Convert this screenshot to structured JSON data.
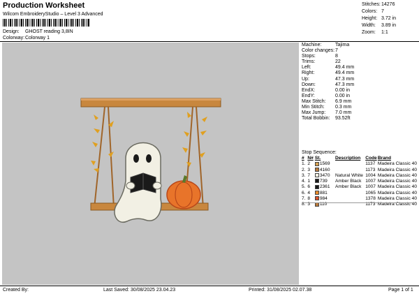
{
  "header": {
    "title": "Production Worksheet",
    "subtitle": "Wilcom EmbroideryStudio – Level 3 Advanced",
    "design_label": "Design:",
    "design_value": "GHOST reading 3,8IN",
    "colorway_label": "Colorway:",
    "colorway_value": "Colorway 1"
  },
  "stats": [
    {
      "label": "Stitches:",
      "value": "14276"
    },
    {
      "label": "Colors:",
      "value": "7"
    },
    {
      "label": "Height:",
      "value": "3.72 in"
    },
    {
      "label": "Width:",
      "value": "3.89 in"
    },
    {
      "label": "Zoom:",
      "value": "1:1"
    }
  ],
  "specs": [
    {
      "label": "Machine:",
      "value": "Tajima"
    },
    {
      "label": "Color changes:",
      "value": "7"
    },
    {
      "label": "Stops:",
      "value": "8"
    },
    {
      "label": "Trims:",
      "value": "22"
    },
    {
      "label": "Left:",
      "value": "49.4 mm"
    },
    {
      "label": "Right:",
      "value": "49.4 mm"
    },
    {
      "label": "Up:",
      "value": "47.3 mm"
    },
    {
      "label": "Down:",
      "value": "47.3 mm"
    },
    {
      "label": "EndX:",
      "value": "0.00 in"
    },
    {
      "label": "EndY:",
      "value": "0.00 in"
    },
    {
      "label": "Max Stitch:",
      "value": "6.9 mm"
    },
    {
      "label": "Min Stitch:",
      "value": "0.3 mm"
    },
    {
      "label": "Max Jump:",
      "value": "7.0 mm"
    },
    {
      "label": "Total Bobbin:",
      "value": "93.52ft"
    }
  ],
  "stop_sequence": {
    "title": "Stop Sequence:",
    "headers": [
      "#",
      "N#",
      "St.",
      "Description",
      "Code",
      "Brand"
    ],
    "rows": [
      {
        "n": "1.",
        "num": "2",
        "color": "#d4a052",
        "st": "1569",
        "desc": "",
        "code": "1137",
        "brand": "Madeira Classic 40"
      },
      {
        "n": "2.",
        "num": "3",
        "color": "#b87a3c",
        "st": "4160",
        "desc": "",
        "code": "1173",
        "brand": "Madeira Classic 40"
      },
      {
        "n": "3.",
        "num": "7",
        "color": "#f2f0e4",
        "st": "3470",
        "desc": "Natural White",
        "code": "1004",
        "brand": "Madeira Classic 40"
      },
      {
        "n": "4.",
        "num": "1",
        "color": "#1a1a1a",
        "st": "739",
        "desc": "Amber Black",
        "code": "1007",
        "brand": "Madeira Classic 40"
      },
      {
        "n": "5.",
        "num": "6",
        "color": "#1a1a1a",
        "st": "2361",
        "desc": "Amber Black",
        "code": "1007",
        "brand": "Madeira Classic 40"
      },
      {
        "n": "6.",
        "num": "4",
        "color": "#e88a2a",
        "st": "881",
        "desc": "",
        "code": "1065",
        "brand": "Madeira Classic 40"
      },
      {
        "n": "7.",
        "num": "8",
        "color": "#d8502a",
        "st": "984",
        "desc": "",
        "code": "1378",
        "brand": "Madeira Classic 40"
      },
      {
        "n": "8.",
        "num": "3",
        "color": "#b87a3c",
        "st": "110",
        "desc": "",
        "code": "1173",
        "brand": "Madeira Classic 40"
      }
    ]
  },
  "footer": {
    "created_by": "Created By:",
    "last_saved": "Last Saved: 30/08/2025 23.04.23",
    "printed": "Printed: 31/08/2025 02.07.38",
    "page": "Page 1 of 1"
  },
  "colors": {
    "panel_bg": "#c4c4c4",
    "wood": "#c8873e",
    "leaf": "#e0a020",
    "ghost": "#f2f0e4",
    "book": "#1a1a1a",
    "pumpkin": "#e8742a",
    "stem": "#5a7a2a"
  }
}
